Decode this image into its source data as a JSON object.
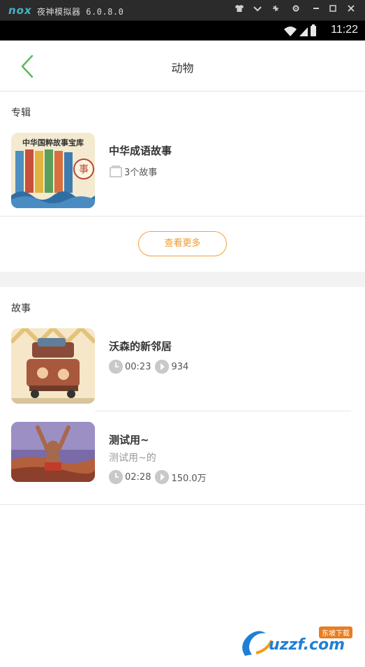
{
  "emulator": {
    "logo": "nox",
    "title": "夜神模拟器 6.0.8.0"
  },
  "status_bar": {
    "time": "11:22"
  },
  "nav": {
    "title": "动物"
  },
  "albums": {
    "section_title": "专辑",
    "items": [
      {
        "title": "中华成语故事",
        "story_count": "3个故事",
        "cover_text": "中华国粹故事宝库"
      }
    ],
    "more_button": "查看更多"
  },
  "stories": {
    "section_title": "故事",
    "items": [
      {
        "title": "沃森的新邻居",
        "duration": "00:23",
        "plays": "934"
      },
      {
        "title": "测试用~",
        "subtitle": "测试用~的",
        "duration": "02:28",
        "plays": "150.0万"
      }
    ]
  },
  "watermark": {
    "text": "uzzf.com",
    "badge": "东坡下载"
  },
  "colors": {
    "accent_orange": "#f09a2a",
    "back_green": "#4caf50",
    "emulator_bar": "#2b2b2b",
    "divider_gray": "#f2f2f2"
  }
}
